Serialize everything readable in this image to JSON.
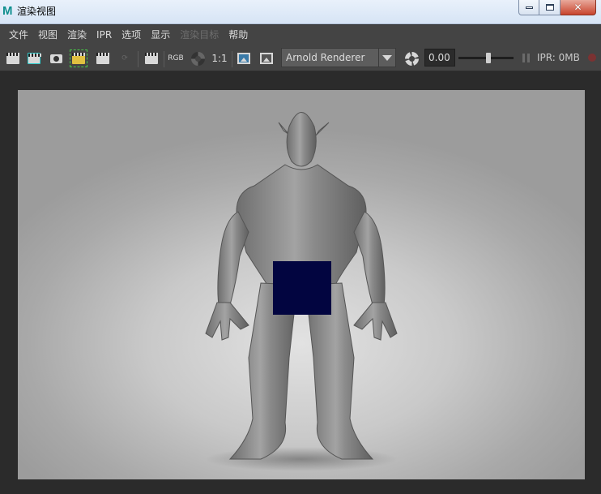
{
  "window": {
    "title": "渲染视图",
    "app_logo": "M"
  },
  "menu": [
    "文件",
    "视图",
    "渲染",
    "IPR",
    "选项",
    "显示",
    "渲染目标",
    "帮助"
  ],
  "menu_disabled": [
    "渲染目标"
  ],
  "toolbar": {
    "rgb_label": "RGB",
    "ratio_label": "1:1",
    "renderer": "Arnold Renderer",
    "exposure": "0.00",
    "exposure_slider_fraction": 0.55,
    "ipr_status": "IPR: 0MB"
  },
  "colors": {
    "censor": "#020540",
    "panel": "#444444",
    "background": "#2b2b2b"
  }
}
